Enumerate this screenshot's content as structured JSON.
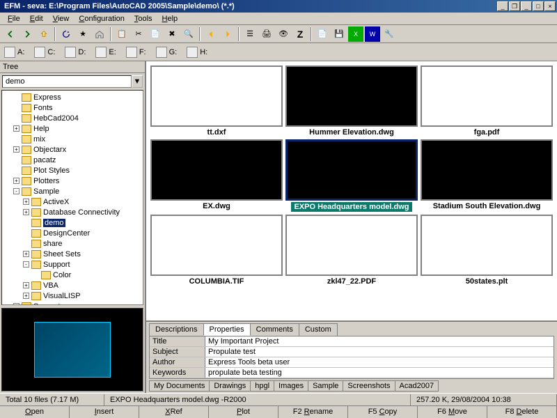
{
  "title": "EFM - seva: E:\\Program Files\\AutoCAD 2005\\Sample\\demo\\ (*.*)",
  "menu": [
    "File",
    "Edit",
    "View",
    "Configuration",
    "Tools",
    "Help"
  ],
  "drives": [
    "A:",
    "C:",
    "D:",
    "E:",
    "F:",
    "G:",
    "H:"
  ],
  "treeHeader": "Tree",
  "treeCombo": "demo",
  "tree": [
    {
      "lbl": "Express",
      "ind": 1
    },
    {
      "lbl": "Fonts",
      "ind": 1
    },
    {
      "lbl": "HebCad2004",
      "ind": 1
    },
    {
      "lbl": "Help",
      "ind": 1,
      "exp": "+"
    },
    {
      "lbl": "mix",
      "ind": 1
    },
    {
      "lbl": "Objectarx",
      "ind": 1,
      "exp": "+"
    },
    {
      "lbl": "pacatz",
      "ind": 1
    },
    {
      "lbl": "Plot Styles",
      "ind": 1
    },
    {
      "lbl": "Plotters",
      "ind": 1,
      "exp": "+"
    },
    {
      "lbl": "Sample",
      "ind": 1,
      "exp": "-"
    },
    {
      "lbl": "ActiveX",
      "ind": 2,
      "exp": "+"
    },
    {
      "lbl": "Database Connectivity",
      "ind": 2,
      "exp": "+"
    },
    {
      "lbl": "demo",
      "ind": 2,
      "sel": true
    },
    {
      "lbl": "DesignCenter",
      "ind": 2
    },
    {
      "lbl": "share",
      "ind": 2
    },
    {
      "lbl": "Sheet Sets",
      "ind": 2,
      "exp": "+"
    },
    {
      "lbl": "Support",
      "ind": 2,
      "exp": "-"
    },
    {
      "lbl": "Color",
      "ind": 3
    },
    {
      "lbl": "VBA",
      "ind": 2,
      "exp": "+"
    },
    {
      "lbl": "VisualLISP",
      "ind": 2,
      "exp": "+"
    },
    {
      "lbl": "Support",
      "ind": 1,
      "exp": "+"
    }
  ],
  "thumbs": [
    [
      {
        "cap": "tt.dxf",
        "dark": false
      },
      {
        "cap": "Hummer Elevation.dwg",
        "dark": true
      },
      {
        "cap": "fga.pdf",
        "dark": false
      }
    ],
    [
      {
        "cap": "EX.dwg",
        "dark": true
      },
      {
        "cap": "EXPO Headquarters model.dwg",
        "dark": true,
        "sel": true
      },
      {
        "cap": "Stadium South Elevation.dwg",
        "dark": true
      }
    ],
    [
      {
        "cap": "COLUMBIA.TIF",
        "dark": false
      },
      {
        "cap": "zkl47_22.PDF",
        "dark": false
      },
      {
        "cap": "50states.plt",
        "dark": false
      }
    ]
  ],
  "propTabs": [
    "Descriptions",
    "Properties",
    "Comments",
    "Custom"
  ],
  "propTabActive": 1,
  "properties": [
    {
      "k": "Title",
      "v": "My Important Project"
    },
    {
      "k": "Subject",
      "v": "Propulate test"
    },
    {
      "k": "Author",
      "v": "Express Tools beta user"
    },
    {
      "k": "Keywords",
      "v": "propulate beta testing"
    }
  ],
  "bottomTabs": [
    "My Documents",
    "Drawings",
    "hpgl",
    "Images",
    "Sample",
    "Screenshots",
    "Acad2007"
  ],
  "status": {
    "left": "Total 10 files (7.17 M)",
    "mid": "EXPO Headquarters model.dwg  -R2000",
    "right": "257.20 K, 29/08/2004  10:38"
  },
  "fnkeys": [
    "Open",
    "Insert",
    "XRef",
    "Plot",
    "F2 Rename",
    "F5 Copy",
    "F6 Move",
    "F8 Delete"
  ]
}
